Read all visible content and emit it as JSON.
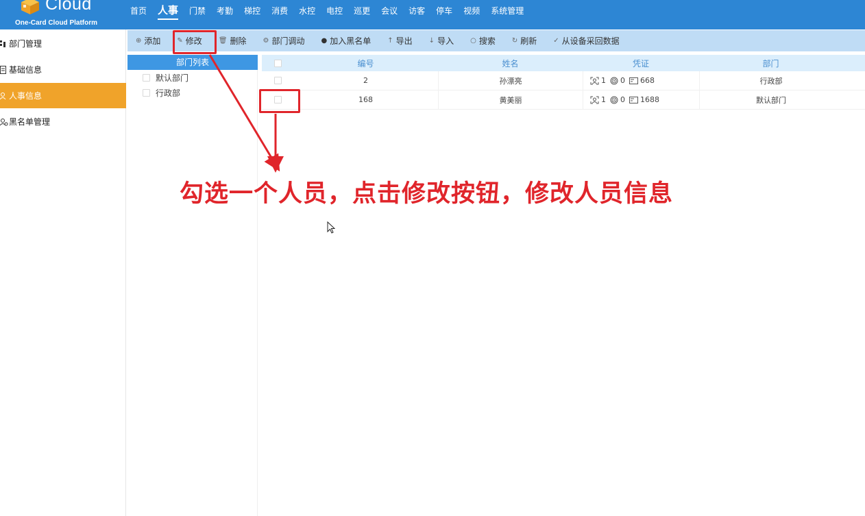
{
  "brand": {
    "name": "Cloud",
    "subtitle": "One-Card Cloud Platform"
  },
  "nav": [
    {
      "label": "首页",
      "active": false
    },
    {
      "label": "人事",
      "active": true
    },
    {
      "label": "门禁",
      "active": false
    },
    {
      "label": "考勤",
      "active": false
    },
    {
      "label": "梯控",
      "active": false
    },
    {
      "label": "消费",
      "active": false
    },
    {
      "label": "水控",
      "active": false
    },
    {
      "label": "电控",
      "active": false
    },
    {
      "label": "巡更",
      "active": false
    },
    {
      "label": "会议",
      "active": false
    },
    {
      "label": "访客",
      "active": false
    },
    {
      "label": "停车",
      "active": false
    },
    {
      "label": "视频",
      "active": false
    },
    {
      "label": "系统管理",
      "active": false
    }
  ],
  "sidebar": {
    "items": [
      {
        "label": "部门管理",
        "icon": "org-chart-icon"
      },
      {
        "label": "基础信息",
        "icon": "document-icon"
      },
      {
        "label": "人事信息",
        "icon": "user-icon",
        "active": true
      },
      {
        "label": "黑名单管理",
        "icon": "user-block-icon"
      }
    ]
  },
  "toolbar": {
    "add": "添加",
    "edit": "修改",
    "delete": "删除",
    "dept_transfer": "部门调动",
    "blacklist": "加入黑名单",
    "export": "导出",
    "import": "导入",
    "search": "搜索",
    "refresh": "刷新",
    "collect": "从设备采回数据"
  },
  "dept_panel": {
    "title": "部门列表",
    "items": [
      "默认部门",
      "行政部"
    ]
  },
  "table": {
    "headers": {
      "number": "编号",
      "name": "姓名",
      "credential": "凭证",
      "department": "部门"
    },
    "rows": [
      {
        "number": "2",
        "name": "孙漂亮",
        "face": "1",
        "fingerprint": "0",
        "card": "668",
        "department": "行政部"
      },
      {
        "number": "168",
        "name": "黄美丽",
        "face": "1",
        "fingerprint": "0",
        "card": "1688",
        "department": "默认部门"
      }
    ]
  },
  "annotation": {
    "text": "勾选一个人员，点击修改按钮，修改人员信息",
    "color": "#e0252b"
  },
  "colors": {
    "topbar": "#2d86d4",
    "active_sidebar": "#f0a32a",
    "toolbar": "#bfdcf5",
    "dept_header": "#3e97e3"
  }
}
